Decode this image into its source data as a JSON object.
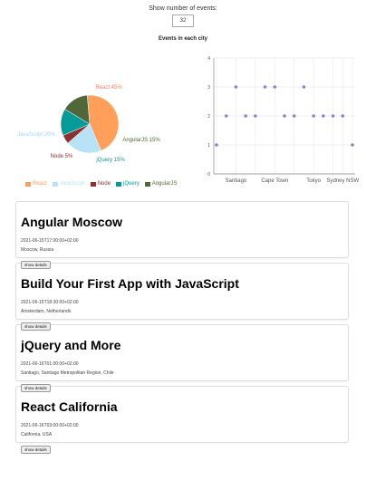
{
  "controls": {
    "label": "Show number of events:",
    "value": "32"
  },
  "charts_title": "Events in each city",
  "pie": {
    "slices": [
      {
        "name": "React",
        "percent": 45,
        "label": "React 45%",
        "color": "#ff9f5a"
      },
      {
        "name": "JavaScript",
        "percent": 20,
        "label": "JavaScript 20%",
        "color": "#b8e2f5"
      },
      {
        "name": "Node",
        "percent": 5,
        "label": "Node 5%",
        "color": "#8c3030"
      },
      {
        "name": "jQuery",
        "percent": 15,
        "label": "jQuery 15%",
        "color": "#069b99"
      },
      {
        "name": "AngularJS",
        "percent": 15,
        "label": "AngularJS 15%",
        "color": "#50673a"
      }
    ]
  },
  "chart_data": {
    "type": "scatter",
    "x_tick_labels": [
      "Santiago",
      "Cape Town",
      "Tokyo",
      "Sydney NSW"
    ],
    "y_ticks": [
      0,
      1,
      2,
      3,
      4
    ],
    "ylim": [
      0,
      4
    ],
    "points": [
      1,
      2,
      3,
      2,
      2,
      3,
      3,
      2,
      2,
      3,
      2,
      2,
      2,
      2,
      1
    ],
    "grid": true,
    "point_color": "#8884d8"
  },
  "events": [
    {
      "title": "Angular Moscow",
      "time": "2021-06-15T17:00:00+02:00",
      "location": "Moscow, Russia",
      "button": "show details"
    },
    {
      "title": "Build Your First App with JavaScript",
      "time": "2021-06-15T18:30:00+02:00",
      "location": "Amsterdam, Netherlands",
      "button": "show details"
    },
    {
      "title": "jQuery and More",
      "time": "2021-06-16T01:00:00+02:00",
      "location": "Santiago, Santiago Metropolitan Region, Chile",
      "button": "show details"
    },
    {
      "title": "React California",
      "time": "2021-06-16T03:00:00+02:00",
      "location": "California, USA",
      "button": "show details"
    }
  ]
}
